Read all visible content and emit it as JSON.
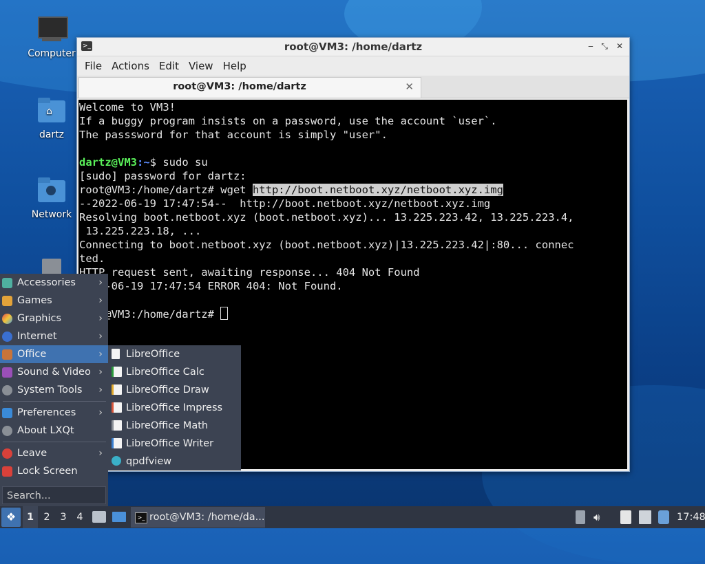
{
  "desktop": {
    "icons": [
      {
        "label": "Computer"
      },
      {
        "label": "dartz"
      },
      {
        "label": "Network"
      }
    ]
  },
  "window": {
    "title": "root@VM3: /home/dartz",
    "menu": [
      "File",
      "Actions",
      "Edit",
      "View",
      "Help"
    ],
    "tab_label": "root@VM3: /home/dartz",
    "terminal": {
      "welcome": [
        "Welcome to VM3!",
        "If a buggy program insists on a password, use the account `user`.",
        "The passsword for that account is simply \"user\"."
      ],
      "prompt_user": "dartz@VM3",
      "prompt_path": ":~",
      "prompt_cmd": "$ sudo su",
      "sudo_line": "[sudo] password for dartz:",
      "root_prompt_1": "root@VM3:/home/dartz# wget ",
      "wget_url": "http://boot.netboot.xyz/netboot.xyz.img",
      "out_1": "--2022-06-19 17:47:54--  http://boot.netboot.xyz/netboot.xyz.img",
      "out_2": "Resolving boot.netboot.xyz (boot.netboot.xyz)... 13.225.223.42, 13.225.223.4,",
      "out_3": " 13.225.223.18, ...",
      "out_4": "Connecting to boot.netboot.xyz (boot.netboot.xyz)|13.225.223.42|:80... connec",
      "out_5": "ted.",
      "out_6": "HTTP request sent, awaiting response... 404 Not Found",
      "out_7": "2022-06-19 17:47:54 ERROR 404: Not Found.",
      "root_prompt_2": "root@VM3:/home/dartz# "
    }
  },
  "start_menu": {
    "items": [
      "Accessories",
      "Games",
      "Graphics",
      "Internet",
      "Office",
      "Sound & Video",
      "System Tools",
      "Preferences",
      "About LXQt",
      "Leave",
      "Lock Screen"
    ],
    "search_placeholder": "Search...",
    "office_submenu": [
      "LibreOffice",
      "LibreOffice Calc",
      "LibreOffice Draw",
      "LibreOffice Impress",
      "LibreOffice Math",
      "LibreOffice Writer",
      "qpdfview"
    ]
  },
  "taskbar": {
    "desktops": [
      "1",
      "2",
      "3",
      "4"
    ],
    "task_label": "root@VM3: /home/da...",
    "clock": "17:48"
  },
  "colors": {
    "menu_bg": "#3c4352",
    "menu_active": "#3f72b0",
    "taskbar_bg": "#2f3542",
    "prompt_green": "#5af05a",
    "prompt_blue": "#5c8cff"
  }
}
